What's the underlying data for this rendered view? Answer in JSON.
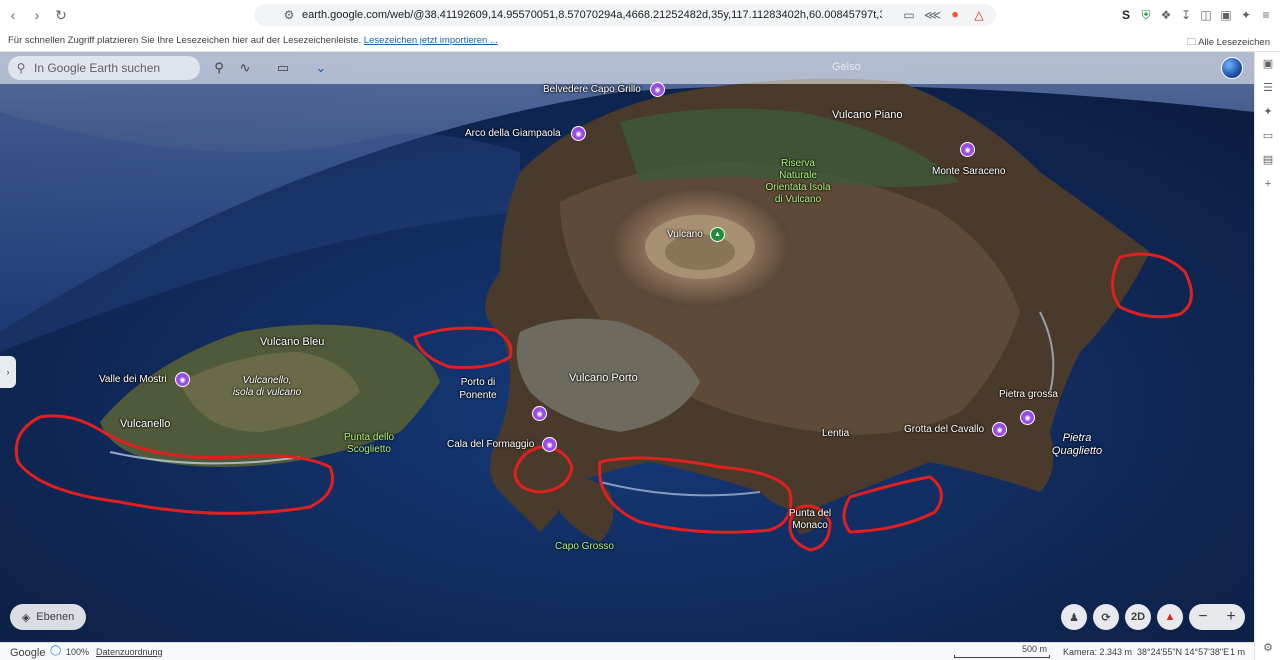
{
  "browser": {
    "url": "earth.google.com/web/@38.41192609,14.95570051,8.57070294a,4668.21252482d,35y,117.11283402h,60.00845797t,360r/data=CgRCAg...",
    "bookmarks_message": "Für schnellen Zugriff platzieren Sie Ihre Lesezeichen hier auf der Lesezeichenleiste.",
    "bookmarks_import_link": "Lesezeichen jetzt importieren ...",
    "all_bookmarks": "Alle Lesezeichen",
    "extension_s_letter": "S"
  },
  "earth": {
    "search_placeholder": "In Google Earth suchen",
    "place_title": "Gelso",
    "layers_button": "Ebenen",
    "view_2d_button": "2D",
    "zoom_out": "−",
    "zoom_in": "+"
  },
  "map_labels": {
    "belvedere": "Belvedere Capo Grillo",
    "arco": "Arco della Giampaola",
    "vulcano_piano": "Vulcano Piano",
    "riserva": "Riserva Naturale Orientata Isola di Vulcano",
    "monte_saraceno": "Monte Saraceno",
    "vulcano": "Vulcano",
    "vulcano_bleu": "Vulcano Bleu",
    "valle_mostri": "Valle dei Mostri",
    "vulcanello_isola": "Vulcanello, isola di vulcano",
    "vulcanello": "Vulcanello",
    "porto_ponente": "Porto di Ponente",
    "vulcano_porto": "Vulcano Porto",
    "pietra_grossa": "Pietra grossa",
    "spiaggia_scoglietto": "Punta dello Scoglietto",
    "cala_formaggio": "Cala del Formaggio",
    "lentia": "Lentia",
    "grotta_cavallo": "Grotta del Cavallo",
    "pietra_quaglietto": "Pietra Quaglietto",
    "punta_monaco": "Punta del Monaco",
    "capo_grosso": "Capo Grosso"
  },
  "status_bar": {
    "brand": "Google",
    "zoom_level": "100%",
    "attribution": "Datenzuordnung",
    "scale": "500 m",
    "camera": "Kamera: 2.343 m",
    "coordinates": "38°24'55\"N 14°57'38\"E",
    "elevation": "1 m"
  },
  "colors": {
    "sea": "#0d1e4a",
    "annotation_red": "#e0201e",
    "poi_purple": "#9b4de0",
    "reserve_green": "#aef07a"
  }
}
